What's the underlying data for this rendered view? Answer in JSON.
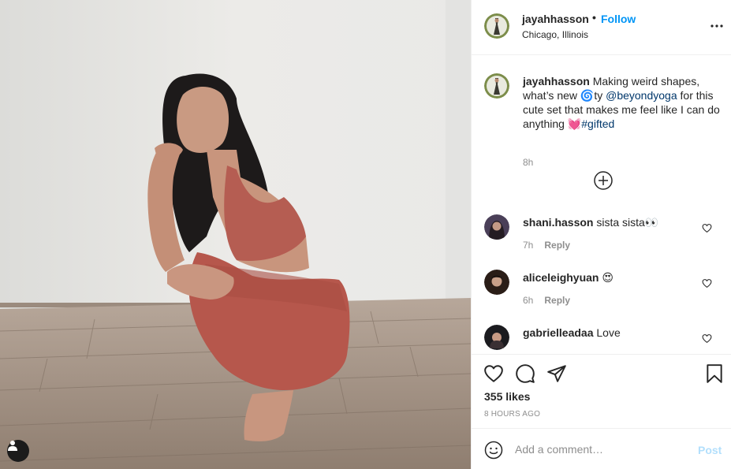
{
  "photo": {
    "alt": "Woman squatting on a wooden floor wearing a rust-colored sports bra and leggings",
    "tag_icon": "user-tag-icon"
  },
  "header": {
    "username": "jayahhasson",
    "separator": "•",
    "follow_label": "Follow",
    "location": "Chicago, Illinois",
    "more_icon": "more-options-icon"
  },
  "caption": {
    "username": "jayahhasson",
    "text_before_mention": " Making weird shapes, what’s new 🌀ty ",
    "mention": "@beyondyoga",
    "text_after_mention": " for this cute set that makes me feel like I can do anything 💓",
    "hashtag": "#gifted",
    "time": "8h"
  },
  "load_more_icon": "plus-circle-icon",
  "comments": [
    {
      "username": "shani.hasson",
      "text": " sista sista👀",
      "time": "7h",
      "reply_label": "Reply"
    },
    {
      "username": "aliceleighyuan",
      "text": " 😍",
      "time": "6h",
      "reply_label": "Reply"
    },
    {
      "username": "gabrielleadaa",
      "text": " Love",
      "time": "",
      "reply_label": ""
    }
  ],
  "actions": {
    "like_icon": "heart-icon",
    "comment_icon": "comment-icon",
    "share_icon": "paper-plane-icon",
    "save_icon": "bookmark-icon",
    "likes": "355 likes",
    "timestamp": "8 HOURS AGO"
  },
  "add_comment": {
    "emoji_icon": "smiley-icon",
    "placeholder": "Add a comment…",
    "post_label": "Post"
  },
  "colors": {
    "link_blue": "#0095f6",
    "mention": "#00376b",
    "post_disabled": "#b2dffc",
    "muted": "#8e8e8e"
  }
}
